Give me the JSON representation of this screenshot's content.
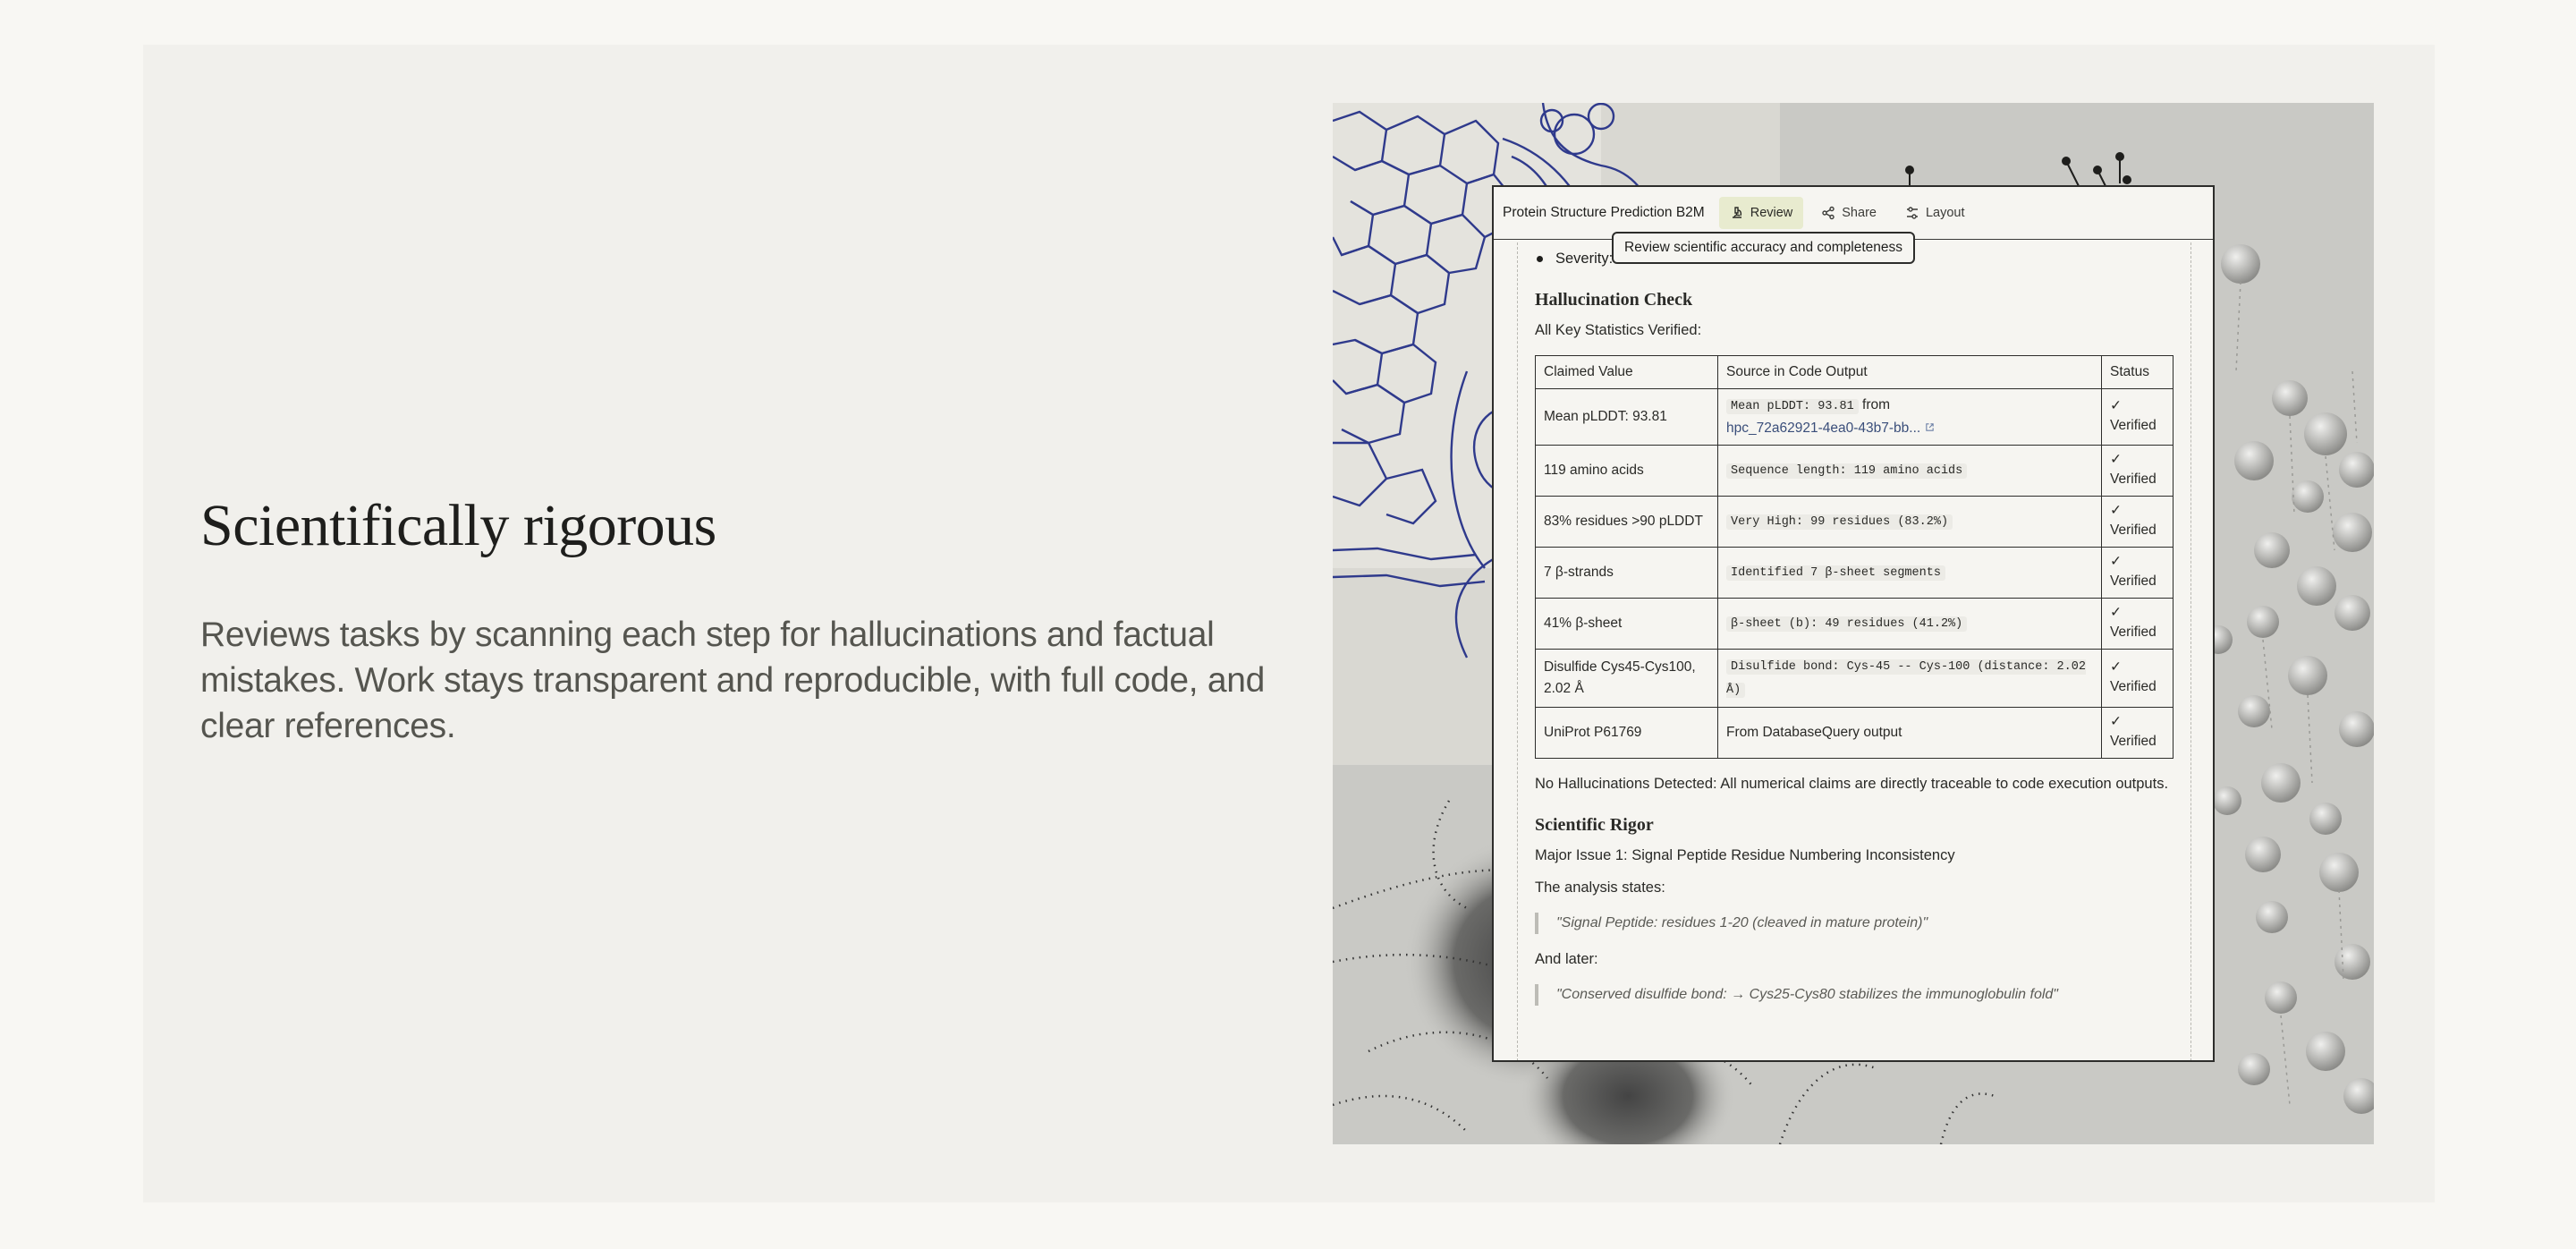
{
  "hero": {
    "title": "Scientifically rigorous",
    "description": "Reviews tasks by scanning each step for hallucinations and factual mistakes. Work stays transparent and reproducible, with full code, and clear references."
  },
  "app": {
    "document_title": "Protein Structure Prediction B2M",
    "toolbar": {
      "review_label": "Review",
      "share_label": "Share",
      "layout_label": "Layout"
    },
    "tooltip": "Review scientific accuracy and completeness"
  },
  "report": {
    "severity_label": "Severity:",
    "hallucination_heading": "Hallucination Check",
    "verified_intro": "All Key Statistics Verified:",
    "table": {
      "headers": [
        "Claimed Value",
        "Source in Code Output",
        "Status"
      ],
      "rows": [
        {
          "claim": "Mean pLDDT: 93.81",
          "source_code": "Mean pLDDT: 93.81",
          "source_suffix": "from",
          "source_link": "hpc_72a62921-4ea0-43b7-bb...",
          "status_mark": "✓",
          "status": "Verified"
        },
        {
          "claim": "119 amino acids",
          "source_code": "Sequence length: 119 amino acids",
          "status_mark": "✓",
          "status": "Verified"
        },
        {
          "claim": "83% residues >90 pLDDT",
          "source_code": "Very High: 99 residues (83.2%)",
          "status_mark": "✓",
          "status": "Verified"
        },
        {
          "claim": "7 β-strands",
          "source_code": "Identified 7 β-sheet segments",
          "status_mark": "✓",
          "status": "Verified"
        },
        {
          "claim": "41% β-sheet",
          "source_code": "β-sheet (b): 49 residues (41.2%)",
          "status_mark": "✓",
          "status": "Verified"
        },
        {
          "claim": "Disulfide Cys45-Cys100, 2.02 Å",
          "source_code": "Disulfide bond: Cys-45 -- Cys-100 (distance: 2.02 Å)",
          "status_mark": "✓",
          "status": "Verified"
        },
        {
          "claim": "UniProt P61769",
          "source_text": "From DatabaseQuery output",
          "status_mark": "✓",
          "status": "Verified"
        }
      ]
    },
    "no_hallucinations": "No Hallucinations Detected: All numerical claims are directly traceable to code execution outputs.",
    "rigor_heading": "Scientific Rigor",
    "major_issue": "Major Issue 1: Signal Peptide Residue Numbering Inconsistency",
    "analysis_states": "The analysis states:",
    "quote_1": "\"Signal Peptide: residues 1-20 (cleaved in mature protein)\"",
    "and_later": "And later:",
    "quote_2": "\"Conserved disulfide bond: → Cys25-Cys80 stabilizes the immunoglobulin fold\""
  }
}
